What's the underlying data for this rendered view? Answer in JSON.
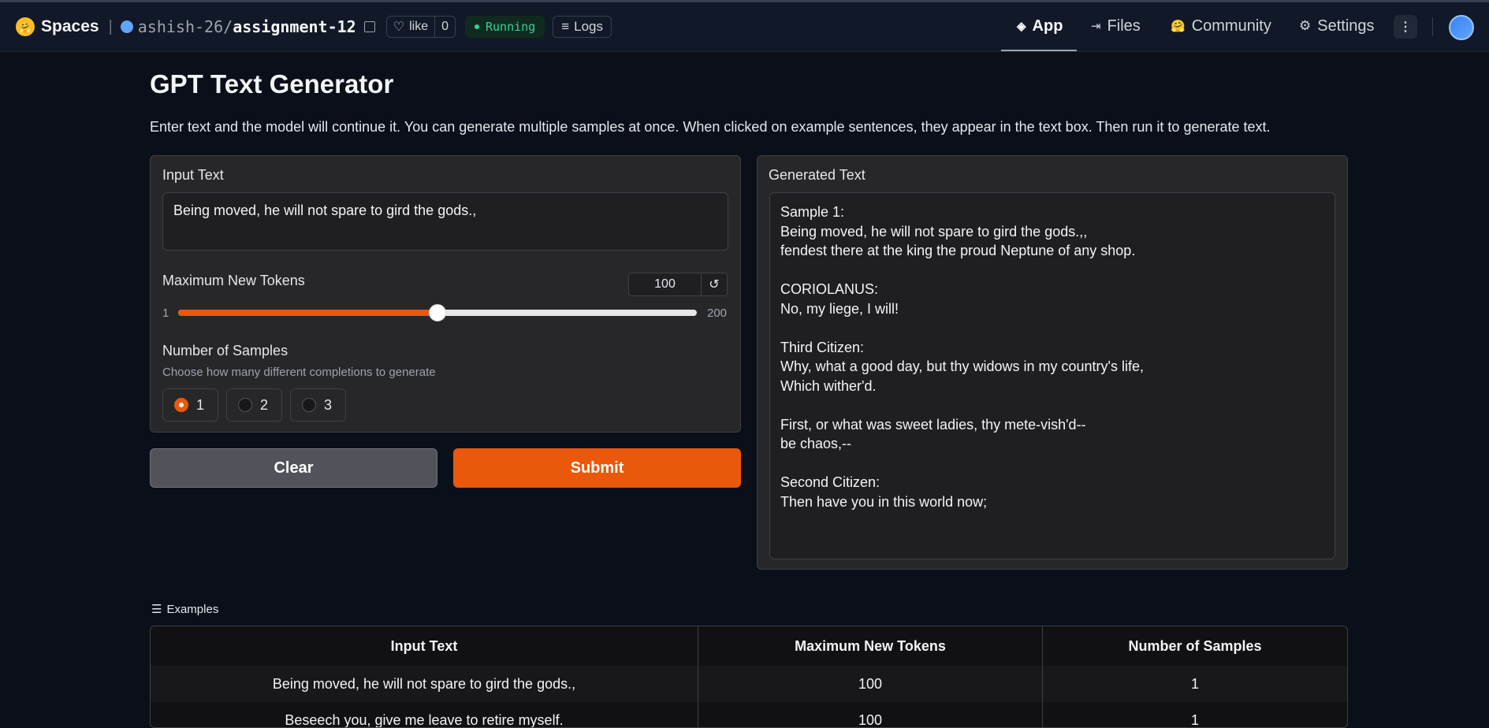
{
  "topbar": {
    "brand": "Spaces",
    "owner": "ashish-26/",
    "repo": "assignment-12",
    "like_label": "like",
    "like_count": "0",
    "status": "Running",
    "logs_label": "Logs",
    "nav": {
      "app": "App",
      "files": "Files",
      "community": "Community",
      "settings": "Settings"
    }
  },
  "page": {
    "title": "GPT Text Generator",
    "description": "Enter text and the model will continue it. You can generate multiple samples at once. When clicked on example sentences, they appear in the text box. Then run it to generate text."
  },
  "input": {
    "label": "Input Text",
    "value": "Being moved, he will not spare to gird the gods.,"
  },
  "tokens": {
    "label": "Maximum New Tokens",
    "value": "100",
    "min": "1",
    "max": "200",
    "fraction": 0.5
  },
  "samples": {
    "label": "Number of Samples",
    "info": "Choose how many different completions to generate",
    "options": [
      "1",
      "2",
      "3"
    ],
    "selected": "1"
  },
  "buttons": {
    "clear": "Clear",
    "submit": "Submit"
  },
  "output": {
    "label": "Generated Text",
    "lines": [
      "Sample 1:",
      "Being moved, he will not spare to gird the gods.,,",
      "fendest there at the king the proud Neptune of any shop.",
      "",
      "CORIOLANUS:",
      "No, my liege, I will!",
      "",
      "Third Citizen:",
      "Why, what a good day, but thy widows in my country's life,",
      "Which wither'd.",
      "",
      "First, or what was sweet ladies, thy mete-vish'd--",
      "be chaos,--",
      "",
      "Second Citizen:",
      "Then have you in this world now;"
    ]
  },
  "examples": {
    "label": "Examples",
    "headers": [
      "Input Text",
      "Maximum New Tokens",
      "Number of Samples"
    ],
    "rows": [
      [
        "Being moved, he will not spare to gird the gods.,",
        "100",
        "1"
      ],
      [
        "Beseech you, give me leave to retire myself.",
        "100",
        "1"
      ]
    ]
  },
  "colors": {
    "accent": "#ea580c",
    "background": "#0b0f19",
    "panel": "#27272a"
  }
}
